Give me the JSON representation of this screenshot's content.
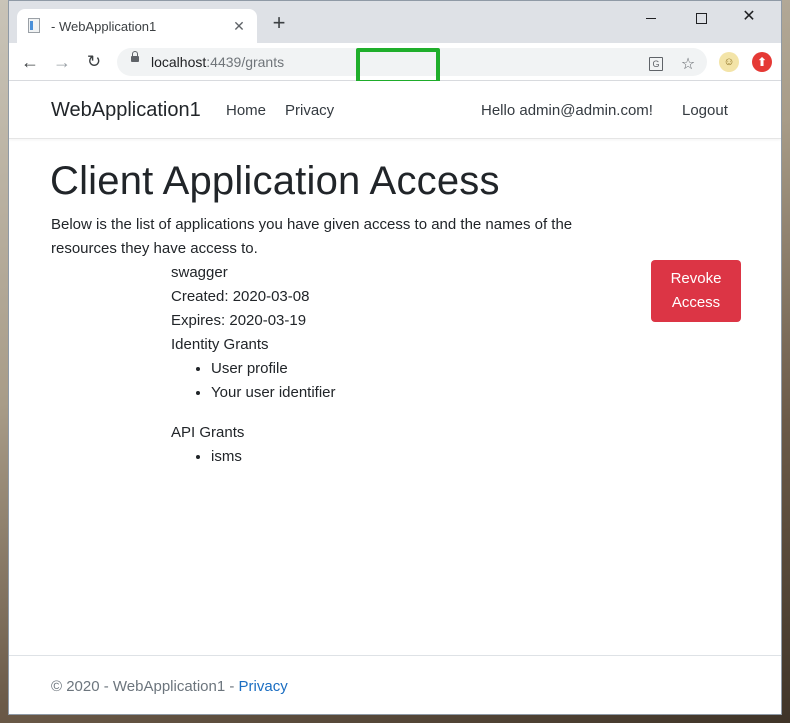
{
  "browser": {
    "tab_title": "- WebApplication1",
    "new_tab_symbol": "+",
    "url_host": "localhost",
    "url_port": ":4439",
    "url_path": "/grants",
    "highlight_color": "#1fae2b"
  },
  "navbar": {
    "brand": "WebApplication1",
    "links": [
      "Home",
      "Privacy"
    ],
    "greeting": "Hello admin@admin.com!",
    "logout": "Logout"
  },
  "main": {
    "title": "Client Application Access",
    "description": "Below is the list of applications you have given access to and the names of the resources they have access to.",
    "grants": [
      {
        "client_name": "swagger",
        "created": "Created: 2020-03-08",
        "expires": "Expires: 2020-03-19",
        "identity_header": "Identity Grants",
        "identity_grants": [
          "User profile",
          "Your user identifier"
        ],
        "api_header": "API Grants",
        "api_grants": [
          "isms"
        ],
        "revoke_label": "Revoke Access"
      }
    ]
  },
  "footer": {
    "text": "© 2020 - WebApplication1 - ",
    "link": "Privacy"
  },
  "colors": {
    "revoke_button": "#dc3545",
    "link": "#1b6ec2"
  }
}
